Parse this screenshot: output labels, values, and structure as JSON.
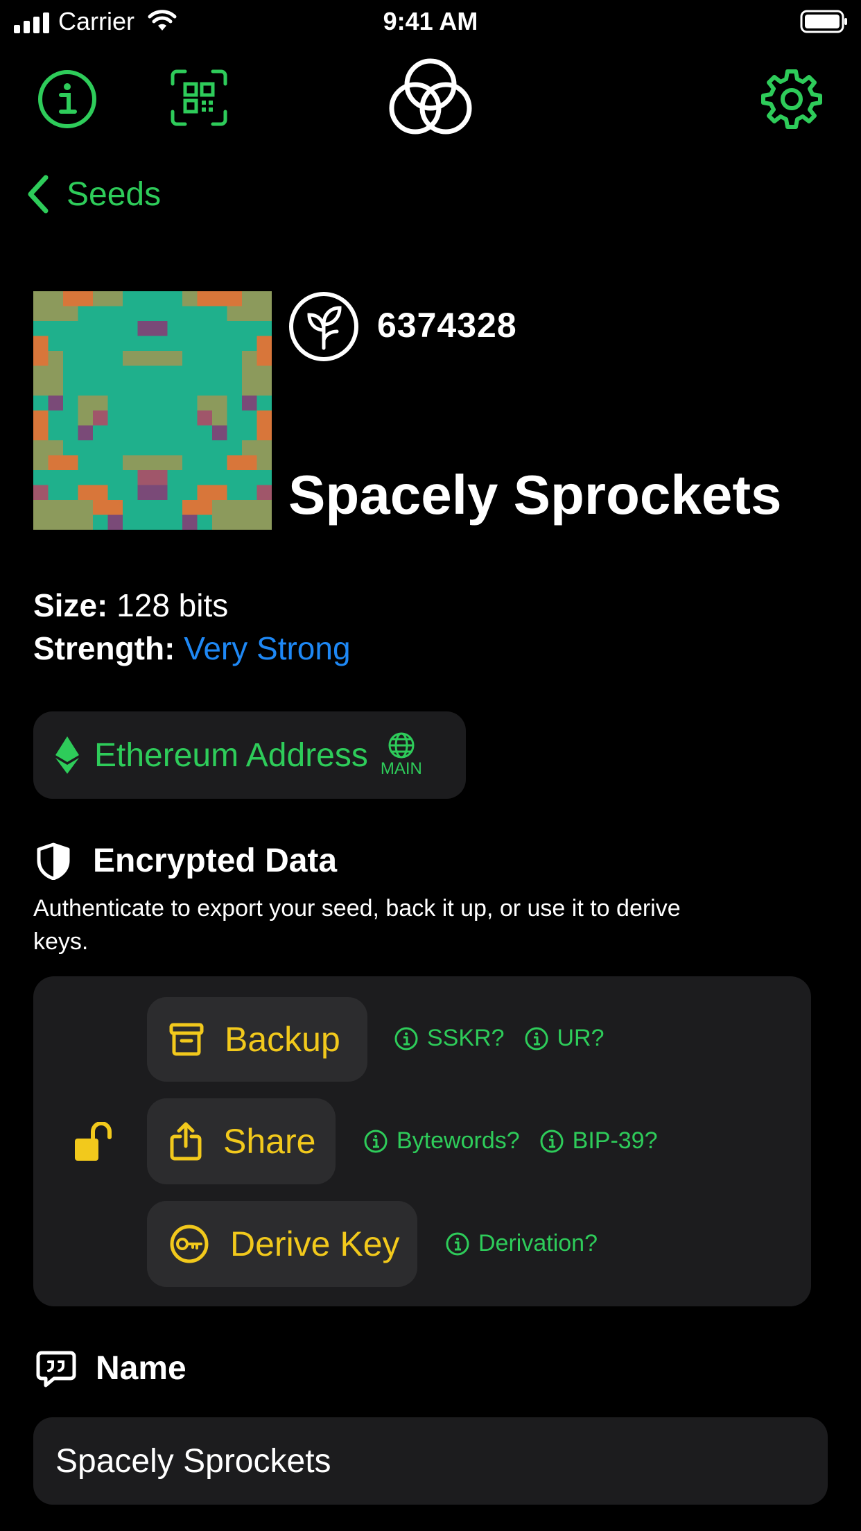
{
  "status_bar": {
    "carrier": "Carrier",
    "time": "9:41 AM"
  },
  "nav": {
    "back_label": "Seeds"
  },
  "seed": {
    "identifier": "6374328",
    "title": "Spacely Sprockets",
    "size_label": "Size:",
    "size_value": "128 bits",
    "strength_label": "Strength:",
    "strength_value": "Very Strong"
  },
  "ethereum": {
    "label": "Ethereum Address",
    "network": "MAIN"
  },
  "encrypted": {
    "heading": "Encrypted Data",
    "description": "Authenticate to export your seed, back it up, or use it to derive keys.",
    "actions": [
      {
        "label": "Backup",
        "icon": "archive-box-icon",
        "helps": [
          "SSKR?",
          "UR?"
        ]
      },
      {
        "label": "Share",
        "icon": "share-icon",
        "helps": [
          "Bytewords?",
          "BIP-39?"
        ]
      },
      {
        "label": "Derive Key",
        "icon": "key-icon",
        "helps": [
          "Derivation?"
        ]
      }
    ]
  },
  "name_section": {
    "heading": "Name",
    "value": "Spacely Sprockets"
  },
  "colors": {
    "accent_green": "#2ecc5a",
    "accent_yellow": "#f2c91c",
    "strength_blue": "#1e88f5",
    "card_bg": "#1c1c1e"
  }
}
